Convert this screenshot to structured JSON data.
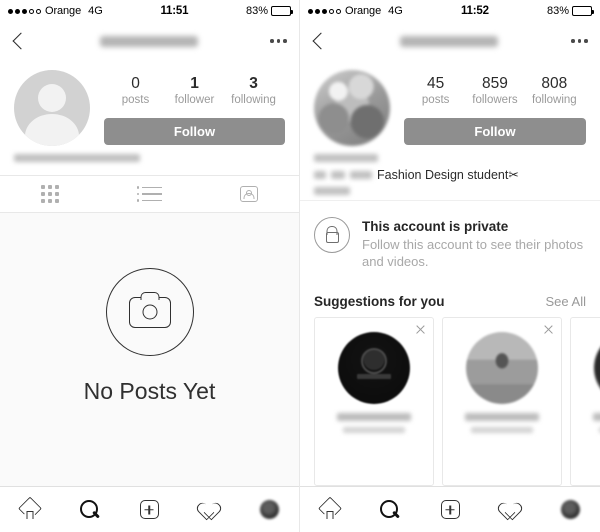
{
  "screens": [
    {
      "id": "left",
      "status_bar": {
        "signal_dots_filled": 3,
        "signal_dots_hollow": 2,
        "carrier": "Orange",
        "network": "4G",
        "time": "11:51",
        "battery_pct": "83%"
      },
      "nav": {
        "back_icon": "chevron-left-icon",
        "title_redacted": true,
        "more_icon": "ellipsis-icon"
      },
      "profile": {
        "avatar_type": "default-silhouette",
        "username_redacted": true,
        "stats": [
          {
            "num": "0",
            "label": "posts",
            "bold": false
          },
          {
            "num": "1",
            "label": "follower",
            "bold": true
          },
          {
            "num": "3",
            "label": "following",
            "bold": true
          }
        ],
        "follow_label": "Follow"
      },
      "tabs": [
        {
          "icon": "grid-icon",
          "active": true
        },
        {
          "icon": "list-icon",
          "active": false
        },
        {
          "icon": "tagged-icon",
          "active": false
        }
      ],
      "empty_state": {
        "icon": "camera-icon",
        "text": "No Posts Yet"
      }
    },
    {
      "id": "right",
      "status_bar": {
        "signal_dots_filled": 3,
        "signal_dots_hollow": 2,
        "carrier": "Orange",
        "network": "4G",
        "time": "11:52",
        "battery_pct": "83%"
      },
      "nav": {
        "back_icon": "chevron-left-icon",
        "title_redacted": true,
        "more_icon": "ellipsis-icon"
      },
      "profile": {
        "avatar_type": "photo-blurred",
        "stats": [
          {
            "num": "45",
            "label": "posts",
            "bold": false
          },
          {
            "num": "859",
            "label": "followers",
            "bold": false
          },
          {
            "num": "808",
            "label": "following",
            "bold": false
          }
        ],
        "follow_label": "Follow"
      },
      "bio": {
        "name_redacted": true,
        "text": "Fashion Design student",
        "emoji": "✂",
        "extra_redacted": true
      },
      "private_notice": {
        "icon": "lock-icon",
        "title": "This account is private",
        "subtitle": "Follow this account to see their photos and videos."
      },
      "suggestions": {
        "title": "Suggestions for you",
        "see_all": "See All",
        "cards": [
          {
            "avatar": "dark-logo",
            "name_redacted": true,
            "username_redacted": true,
            "close_icon": "close-icon"
          },
          {
            "avatar": "photo-person",
            "name_redacted": true,
            "username_redacted": true,
            "close_icon": "close-icon"
          },
          {
            "avatar": "photo-dark",
            "name_redacted": true,
            "username_redacted": true,
            "close_icon": "close-icon"
          }
        ]
      }
    }
  ],
  "bottom_nav": [
    {
      "icon": "home-icon",
      "active": false
    },
    {
      "icon": "search-icon",
      "active": true
    },
    {
      "icon": "add-post-icon",
      "active": false
    },
    {
      "icon": "activity-heart-icon",
      "active": false
    },
    {
      "icon": "profile-avatar-icon",
      "active": false
    }
  ],
  "colors": {
    "follow_button": "#8e8e8e",
    "text_primary": "#262626",
    "text_secondary": "#9a9a9a",
    "background": "#ffffff",
    "empty_background": "#fafafa"
  }
}
